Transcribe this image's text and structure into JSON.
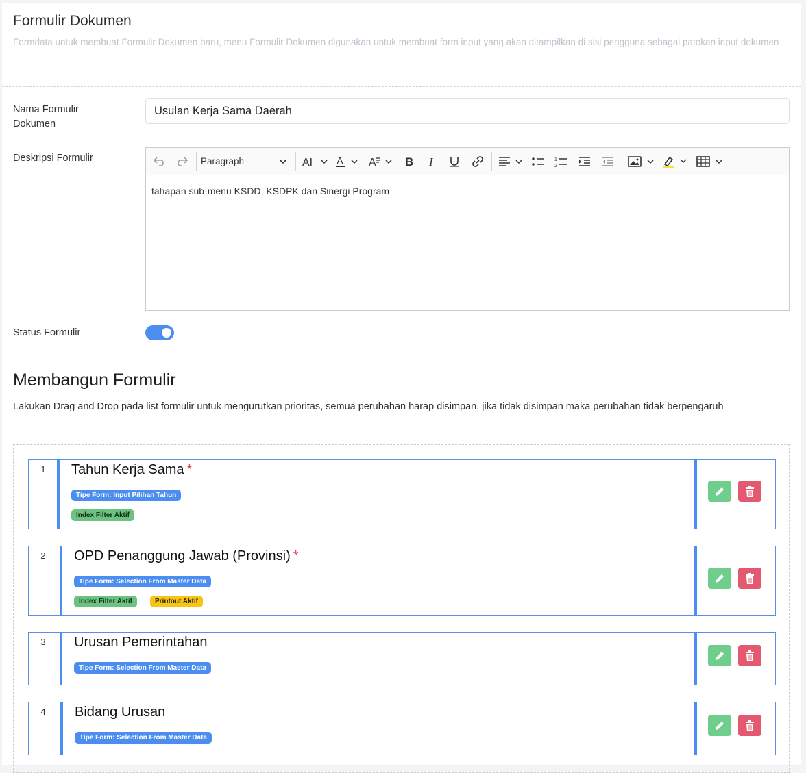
{
  "header": {
    "title": "Formulir Dokumen",
    "subtitle": "Formdata untuk membuat Formulir Dokumen baru, menu Formulir Dokumen digunakan untuk membuat form input yang akan ditampilkan di sisi pengguna sebagai patokan input dokumen"
  },
  "form": {
    "name_label": "Nama Formulir Dokumen",
    "name_value": "Usulan Kerja Sama Daerah",
    "desc_label": "Deskripsi Formulir",
    "desc_value": "tahapan sub-menu KSDD, KSDPK dan Sinergi Program",
    "status_label": "Status Formulir",
    "status_on": true
  },
  "toolbar": {
    "paragraph_label": "Paragraph",
    "icons": [
      "undo-icon",
      "redo-icon",
      "font-size-icon",
      "font-color-icon",
      "font-family-icon",
      "bold-icon",
      "italic-icon",
      "underline-icon",
      "link-icon",
      "align-icon",
      "bulleted-list-icon",
      "numbered-list-icon",
      "indent-icon",
      "outdent-icon",
      "image-icon",
      "highlight-icon",
      "table-icon"
    ]
  },
  "builder": {
    "title": "Membangun Formulir",
    "description": "Lakukan Drag and Drop pada list formulir untuk mengurutkan prioritas, semua perubahan harap disimpan, jika tidak disimpan maka perubahan tidak berpengaruh",
    "items": [
      {
        "number": "1",
        "title": "Tahun Kerja Sama",
        "required": "*",
        "type": "Tipe Form: Input Pilihan Tahun",
        "filter": "Index Filter Aktif",
        "printout": ""
      },
      {
        "number": "2",
        "title": "OPD Penanggung Jawab (Provinsi)",
        "required": "*",
        "type": "Tipe Form: Selection From Master Data",
        "filter": "Index Filter Aktif",
        "printout": "Printout Aktif"
      },
      {
        "number": "3",
        "title": "Urusan Pemerintahan",
        "required": "",
        "type": "Tipe Form: Selection From Master Data",
        "filter": "",
        "printout": ""
      },
      {
        "number": "4",
        "title": "Bidang Urusan",
        "required": "",
        "type": "Tipe Form: Selection From Master Data",
        "filter": "",
        "printout": ""
      }
    ]
  },
  "colors": {
    "accent": "#4c8df0",
    "edit_button": "#6fce8b",
    "delete_button": "#e35a70",
    "printout_badge": "#f5c518",
    "required_mark": "#e04050"
  }
}
